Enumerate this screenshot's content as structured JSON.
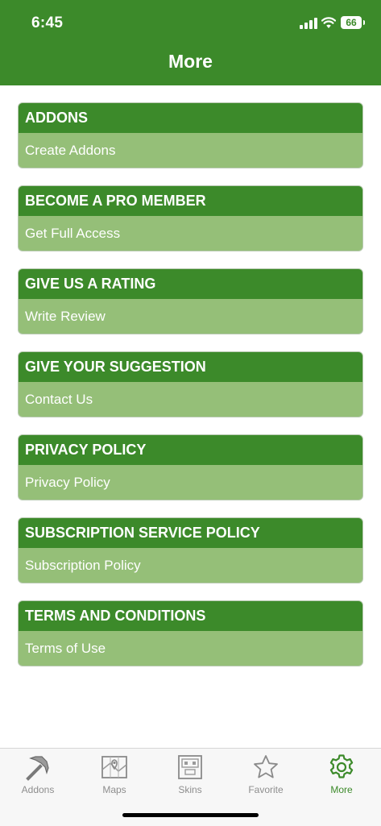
{
  "status": {
    "time": "6:45",
    "battery": "66"
  },
  "header": {
    "title": "More"
  },
  "items": [
    {
      "title": "ADDONS",
      "action": "Create Addons"
    },
    {
      "title": "BECOME A PRO MEMBER",
      "action": "Get Full Access"
    },
    {
      "title": "GIVE US A RATING",
      "action": "Write Review"
    },
    {
      "title": "GIVE YOUR SUGGESTION",
      "action": "Contact Us"
    },
    {
      "title": "PRIVACY POLICY",
      "action": "Privacy Policy"
    },
    {
      "title": "SUBSCRIPTION SERVICE POLICY",
      "action": "Subscription Policy"
    },
    {
      "title": "TERMS AND CONDITIONS",
      "action": "Terms of Use"
    }
  ],
  "tabs": [
    {
      "label": "Addons",
      "icon": "pickaxe-icon"
    },
    {
      "label": "Maps",
      "icon": "map-icon"
    },
    {
      "label": "Skins",
      "icon": "skin-icon"
    },
    {
      "label": "Favorite",
      "icon": "star-icon"
    },
    {
      "label": "More",
      "icon": "gear-icon",
      "active": true
    }
  ],
  "colors": {
    "primary": "#3c8a2a",
    "light": "#95bf78",
    "inactive": "#8e8e8e"
  }
}
